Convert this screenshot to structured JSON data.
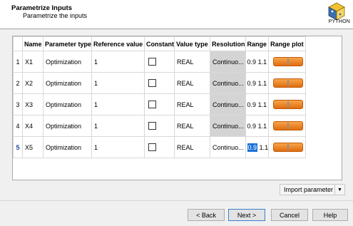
{
  "header": {
    "title": "Parametrize Inputs",
    "subtitle": "Parametrize the inputs",
    "logo_text": "PYTHON",
    "logo_icon": "python-logo-icon"
  },
  "table": {
    "columns": [
      "",
      "Name",
      "Parameter type",
      "Reference value",
      "Constant",
      "Value type",
      "Resolution",
      "Range",
      "Range plot"
    ],
    "rows": [
      {
        "index": "1",
        "name": "X1",
        "param_type": "Optimization",
        "ref": "1",
        "constant": false,
        "value_type": "REAL",
        "resolution": "Continuo...",
        "range_min": "0.9",
        "range_max": "1.1"
      },
      {
        "index": "2",
        "name": "X2",
        "param_type": "Optimization",
        "ref": "1",
        "constant": false,
        "value_type": "REAL",
        "resolution": "Continuo...",
        "range_min": "0.9",
        "range_max": "1.1"
      },
      {
        "index": "3",
        "name": "X3",
        "param_type": "Optimization",
        "ref": "1",
        "constant": false,
        "value_type": "REAL",
        "resolution": "Continuo...",
        "range_min": "0.9",
        "range_max": "1.1"
      },
      {
        "index": "4",
        "name": "X4",
        "param_type": "Optimization",
        "ref": "1",
        "constant": false,
        "value_type": "REAL",
        "resolution": "Continuo...",
        "range_min": "0.9",
        "range_max": "1.1"
      },
      {
        "index": "5",
        "name": "X5",
        "param_type": "Optimization",
        "ref": "1",
        "constant": false,
        "value_type": "REAL",
        "resolution": "Continuo...",
        "range_min": "0.9",
        "range_max": "1.1",
        "selected": true
      }
    ]
  },
  "import_button": {
    "label": "Import parameter"
  },
  "buttons": {
    "back": "< Back",
    "next": "Next >",
    "cancel": "Cancel",
    "help": "Help"
  },
  "colors": {
    "range_bar": "#f08a24",
    "selection": "#1c72d6",
    "resolution_cell": "#d4d4d4"
  }
}
